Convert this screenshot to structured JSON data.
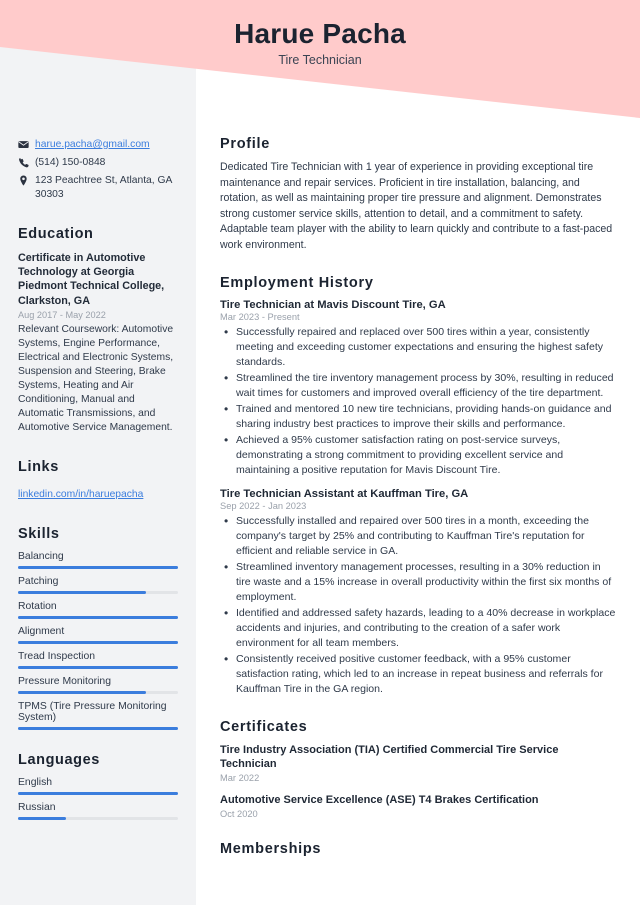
{
  "header": {
    "name": "Harue Pacha",
    "role": "Tire Technician",
    "banner_color": "#ffcbcb"
  },
  "theme": {
    "accent": "#3b7ddd",
    "sidebar_bg": "#f2f3f5",
    "text": "#2f3a4a",
    "muted": "#9aa1ab"
  },
  "contact": {
    "email": "harue.pacha@gmail.com",
    "phone": "(514) 150-0848",
    "address": "123 Peachtree St, Atlanta, GA 30303",
    "icons": {
      "email": "envelope-icon",
      "phone": "phone-icon",
      "address": "location-pin-icon"
    }
  },
  "sidebar": {
    "education_heading": "Education",
    "education": [
      {
        "title": "Certificate in Automotive Technology at Georgia Piedmont Technical College, Clarkston, GA",
        "date": "Aug 2017 - May 2022",
        "description": "Relevant Coursework: Automotive Systems, Engine Performance, Electrical and Electronic Systems, Suspension and Steering, Brake Systems, Heating and Air Conditioning, Manual and Automatic Transmissions, and Automotive Service Management."
      }
    ],
    "links_heading": "Links",
    "links": [
      {
        "label": "linkedin.com/in/haruepacha"
      }
    ],
    "skills_heading": "Skills",
    "skills": [
      {
        "label": "Balancing",
        "level": 100
      },
      {
        "label": "Patching",
        "level": 80
      },
      {
        "label": "Rotation",
        "level": 100
      },
      {
        "label": "Alignment",
        "level": 100
      },
      {
        "label": "Tread Inspection",
        "level": 100
      },
      {
        "label": "Pressure Monitoring",
        "level": 80
      },
      {
        "label": "TPMS (Tire Pressure Monitoring System)",
        "level": 100
      }
    ],
    "languages_heading": "Languages",
    "languages": [
      {
        "label": "English",
        "level": 100
      },
      {
        "label": "Russian",
        "level": 30
      }
    ]
  },
  "main": {
    "profile_heading": "Profile",
    "profile_text": "Dedicated Tire Technician with 1 year of experience in providing exceptional tire maintenance and repair services. Proficient in tire installation, balancing, and rotation, as well as maintaining proper tire pressure and alignment. Demonstrates strong customer service skills, attention to detail, and a commitment to safety. Adaptable team player with the ability to learn quickly and contribute to a fast-paced work environment.",
    "employment_heading": "Employment History",
    "jobs": [
      {
        "title": "Tire Technician at Mavis Discount Tire, GA",
        "date": "Mar 2023 - Present",
        "bullets": [
          "Successfully repaired and replaced over 500 tires within a year, consistently meeting and exceeding customer expectations and ensuring the highest safety standards.",
          "Streamlined the tire inventory management process by 30%, resulting in reduced wait times for customers and improved overall efficiency of the tire department.",
          "Trained and mentored 10 new tire technicians, providing hands-on guidance and sharing industry best practices to improve their skills and performance.",
          "Achieved a 95% customer satisfaction rating on post-service surveys, demonstrating a strong commitment to providing excellent service and maintaining a positive reputation for Mavis Discount Tire."
        ]
      },
      {
        "title": "Tire Technician Assistant at Kauffman Tire, GA",
        "date": "Sep 2022 - Jan 2023",
        "bullets": [
          "Successfully installed and repaired over 500 tires in a month, exceeding the company's target by 25% and contributing to Kauffman Tire's reputation for efficient and reliable service in GA.",
          "Streamlined inventory management processes, resulting in a 30% reduction in tire waste and a 15% increase in overall productivity within the first six months of employment.",
          "Identified and addressed safety hazards, leading to a 40% decrease in workplace accidents and injuries, and contributing to the creation of a safer work environment for all team members.",
          "Consistently received positive customer feedback, with a 95% customer satisfaction rating, which led to an increase in repeat business and referrals for Kauffman Tire in the GA region."
        ]
      }
    ],
    "certificates_heading": "Certificates",
    "certificates": [
      {
        "title": "Tire Industry Association (TIA) Certified Commercial Tire Service Technician",
        "date": "Mar 2022"
      },
      {
        "title": "Automotive Service Excellence (ASE) T4 Brakes Certification",
        "date": "Oct 2020"
      }
    ],
    "memberships_heading": "Memberships"
  }
}
